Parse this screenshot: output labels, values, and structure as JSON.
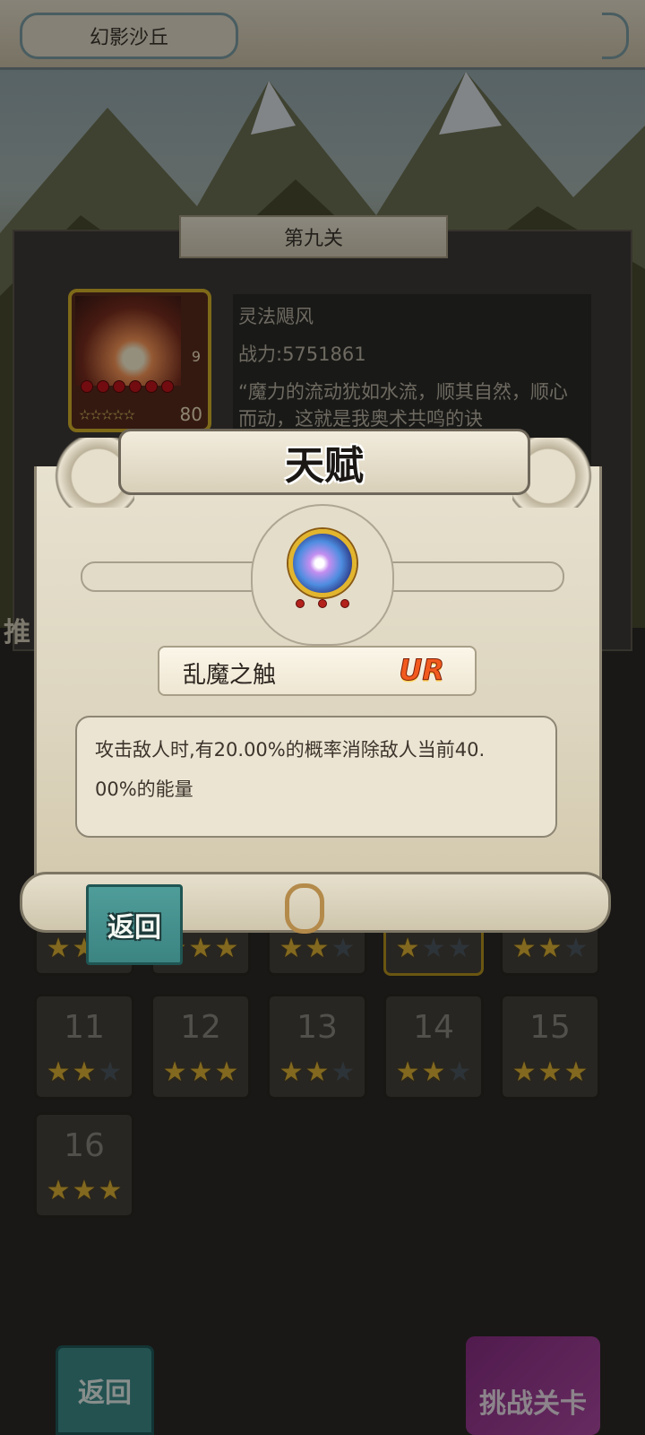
{
  "header": {
    "title": "幻影沙丘"
  },
  "stage": {
    "title": "第九关",
    "hero": {
      "level": "80",
      "corner_value": "9",
      "red_dots": 6
    },
    "info": {
      "name": "灵法飓风",
      "power": "战力:5751861",
      "quote": "“魔力的流动犹如水流，顺其自然，顺心而动，这就是我奥术共鸣的诀"
    },
    "side_text": "推"
  },
  "grid": {
    "cells": [
      {
        "number": "11",
        "stars": 2
      },
      {
        "number": "12",
        "stars": 3
      },
      {
        "number": "13",
        "stars": 2
      },
      {
        "number": "14",
        "stars": 2
      },
      {
        "number": "15",
        "stars": 3
      },
      {
        "number": "16",
        "stars": 3
      }
    ],
    "partial_row": [
      {
        "stars": 2
      },
      {
        "stars": 3
      },
      {
        "stars": 2
      },
      {
        "stars": 1
      },
      {
        "stars": 2
      }
    ]
  },
  "bottom": {
    "back_label": "返回",
    "challenge_label": "挑战关卡"
  },
  "popup": {
    "title": "天赋",
    "talent_name": "乱魔之触",
    "rarity": "UR",
    "description_line1": "攻击敌人时,有20.00%的概率消除敌人当前40.",
    "description_line2": "00%的能量",
    "back_label": "返回"
  },
  "colors": {
    "rarity": "#f25a1e",
    "star_on": "#e0b636",
    "star_off": "#4f5a63",
    "button_teal": "#3d8d8c"
  }
}
